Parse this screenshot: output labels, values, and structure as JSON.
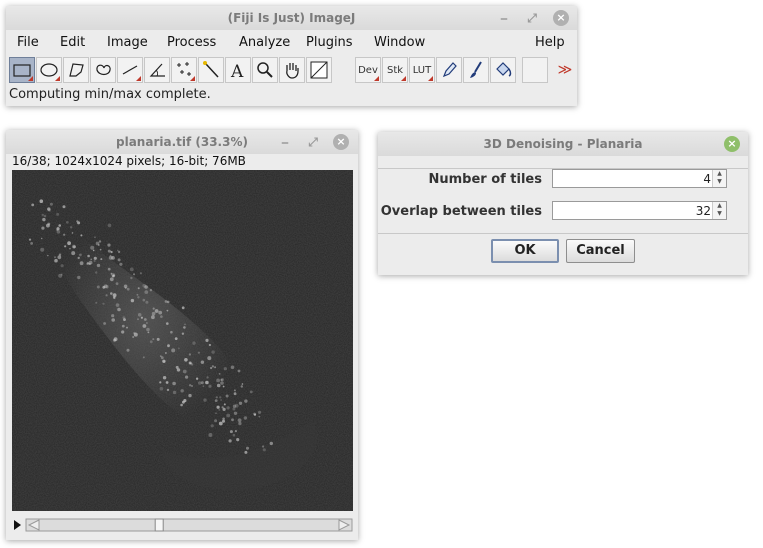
{
  "imagej": {
    "title": "(Fiji Is Just) ImageJ",
    "menus": [
      "File",
      "Edit",
      "Image",
      "Process",
      "Analyze",
      "Plugins",
      "Window",
      "Help"
    ],
    "tools": {
      "dev": "Dev",
      "stk": "Stk",
      "lut": "LUT",
      "more": "≫"
    },
    "status": "Computing min/max complete."
  },
  "image_window": {
    "title": "planaria.tif (33.3%)",
    "info": "16/38; 1024x1024 pixels; 16-bit; 76MB",
    "slice_position": 0.4
  },
  "dialog": {
    "title": "3D Denoising - Planaria",
    "fields": [
      {
        "label": "Number of tiles",
        "value": "4"
      },
      {
        "label": "Overlap between tiles",
        "value": "32"
      }
    ],
    "ok_label": "OK",
    "cancel_label": "Cancel"
  },
  "colors": {
    "accent_close": "#8fbf6a",
    "selected_tool": "#a8b4c8",
    "image_background": "#252525"
  }
}
